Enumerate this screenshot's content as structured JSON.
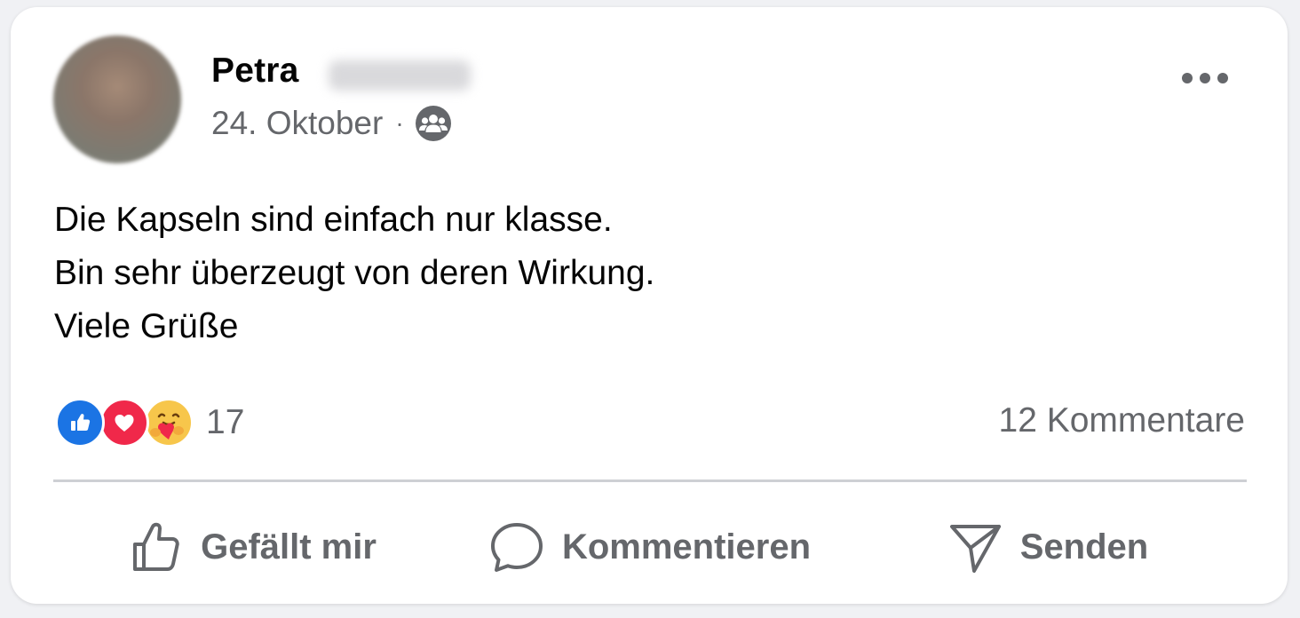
{
  "post": {
    "author_first_name": "Petra",
    "date": "24. Oktober",
    "separator": "·",
    "audience_icon": "friends-icon",
    "text_lines": [
      "Die Kapseln sind einfach nur klasse.",
      "Bin sehr überzeugt von deren Wirkung.",
      "Viele Grüße"
    ]
  },
  "stats": {
    "reactions": [
      "like-icon",
      "love-icon",
      "care-icon"
    ],
    "reaction_count": "17",
    "comments_label": "12 Kommentare"
  },
  "actions": {
    "like_label": "Gefällt mir",
    "comment_label": "Kommentieren",
    "send_label": "Senden"
  },
  "colors": {
    "like_blue": "#1b74e4",
    "love_red": "#f0284a",
    "care_yellow": "#f7c64b",
    "secondary_text": "#65676b",
    "primary_text": "#050505"
  }
}
